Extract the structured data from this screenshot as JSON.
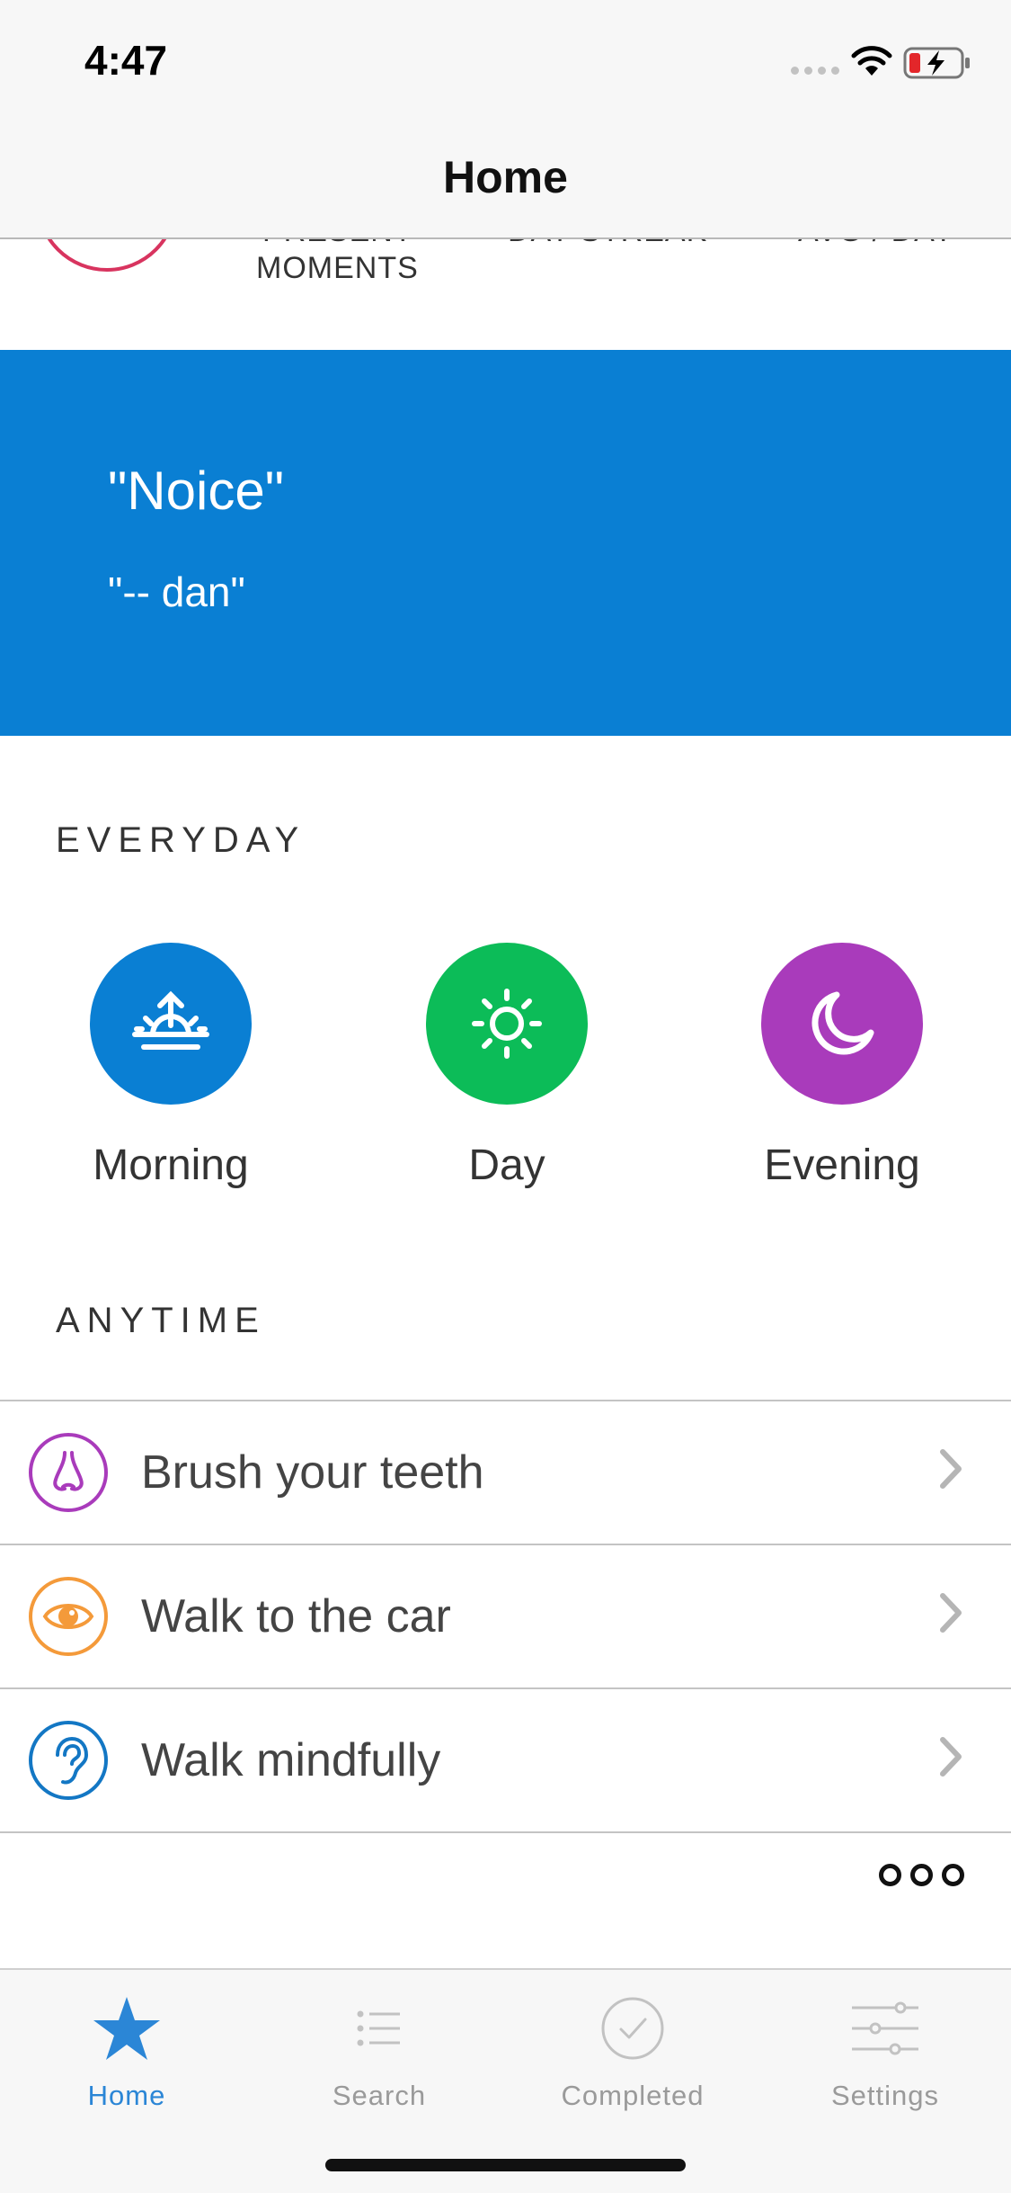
{
  "status": {
    "time": "4:47"
  },
  "nav": {
    "title": "Home"
  },
  "stats": {
    "label1_hidden": "PRESENT",
    "label1": "MOMENTS",
    "label2_hidden": "DAY STREAK",
    "label3_hidden": "AVG / DAY"
  },
  "quote": {
    "text": "\"Noice\"",
    "author": "\"-- dan\"",
    "bg_color": "#0a7fd3"
  },
  "everyday": {
    "title": "EVERYDAY",
    "items": [
      {
        "label": "Morning",
        "icon": "sunrise-icon",
        "color": "#0a7fd3"
      },
      {
        "label": "Day",
        "icon": "sun-icon",
        "color": "#0cbc58"
      },
      {
        "label": "Evening",
        "icon": "moon-icon",
        "color": "#a93bbb"
      }
    ]
  },
  "anytime": {
    "title": "ANYTIME",
    "items": [
      {
        "label": "Brush your teeth",
        "icon": "nose-icon",
        "color": "#a93bbb"
      },
      {
        "label": "Walk to the car",
        "icon": "eye-icon",
        "color": "#f49a3a"
      },
      {
        "label": "Walk mindfully",
        "icon": "ear-icon",
        "color": "#1377c4"
      }
    ]
  },
  "tabs": [
    {
      "label": "Home",
      "icon": "star-icon",
      "active": true
    },
    {
      "label": "Search",
      "icon": "list-icon",
      "active": false
    },
    {
      "label": "Completed",
      "icon": "checkmark-circle-icon",
      "active": false
    },
    {
      "label": "Settings",
      "icon": "sliders-icon",
      "active": false
    }
  ],
  "colors": {
    "accent": "#2b86d6",
    "inactive_tab": "#9a9a9a"
  }
}
